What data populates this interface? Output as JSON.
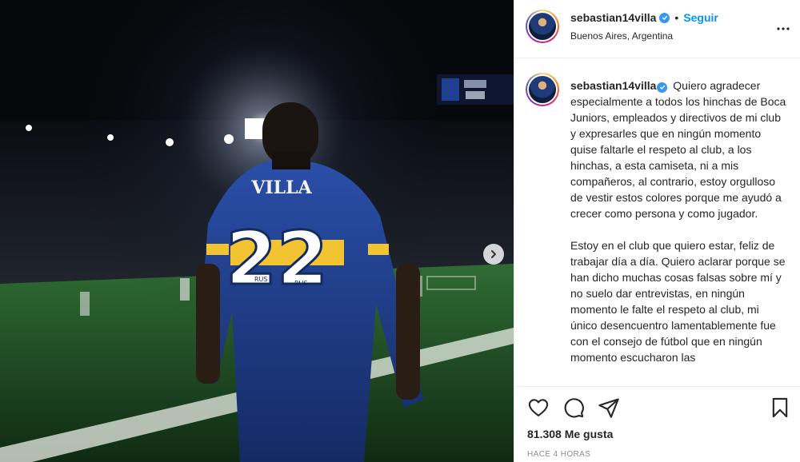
{
  "post": {
    "user": {
      "username": "sebastian14villa",
      "follow_label": "Seguir",
      "location": "Buenos Aires, Argentina",
      "separator": "•"
    },
    "image": {
      "jersey_name": "VILLA",
      "jersey_number": "22",
      "sponsor": "RUS"
    },
    "caption": {
      "username": "sebastian14villa",
      "paragraph_1": "Quiero agradecer especialmente a todos los hinchas de Boca Juniors, empleados y directivos de mi club y expresarles que en ningún momento quise faltarle el respeto al club, a los hinchas, a esta camiseta, ni a mis compañeros, al contrario, estoy orgulloso de vestir estos colores porque me ayudó a crecer como persona y como jugador.",
      "paragraph_2": "Estoy en el club que quiero estar, feliz de trabajar día a día. Quiero aclarar porque se han dicho muchas cosas falsas sobre mí y no suelo dar entrevistas, en ningún momento le falte el respeto al club, mi único desencuentro lamentablemente fue con el consejo de fútbol que en ningún momento escucharon las"
    },
    "stats": {
      "likes": "81.308 Me gusta",
      "time": "HACE 4 HORAS"
    },
    "icons": {
      "verified": "verified-badge-icon",
      "more": "more-options-icon",
      "like": "heart-icon",
      "comment": "comment-icon",
      "share": "share-icon",
      "save": "bookmark-icon",
      "next": "chevron-right-icon"
    },
    "colors": {
      "accent": "#0095f6",
      "verified": "#3897f0",
      "boca_blue": "#1f3f8f",
      "boca_gold": "#f3c431"
    }
  }
}
